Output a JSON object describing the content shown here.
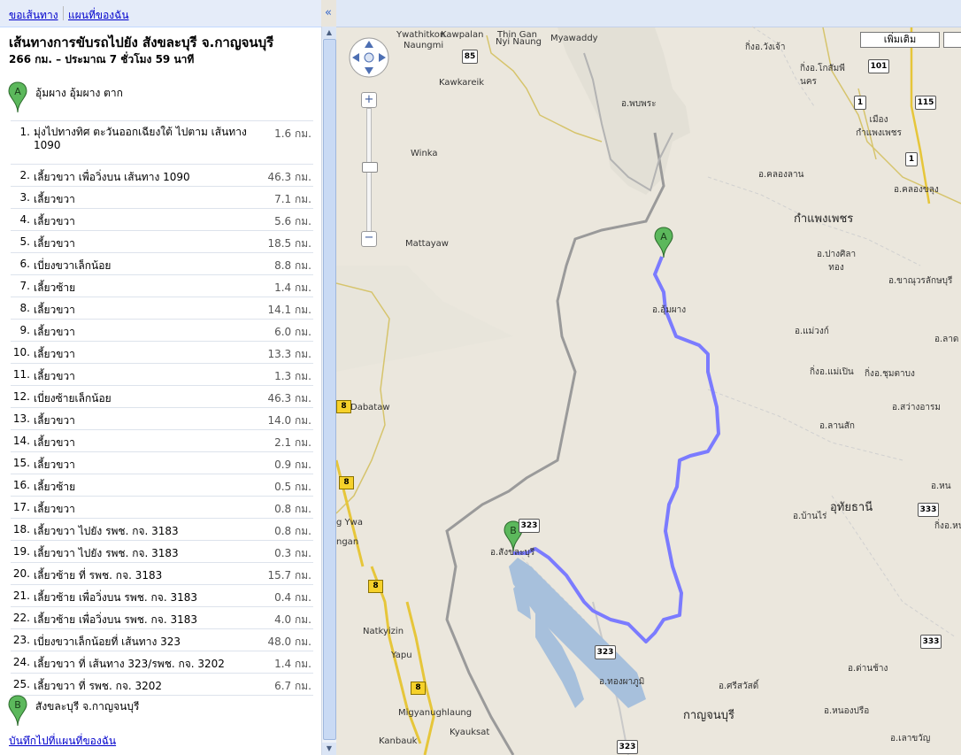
{
  "tabs": {
    "directions": "ขอเส้นทาง",
    "my_maps": "แผนที่ของฉัน"
  },
  "collapse_glyph": "«",
  "route": {
    "title": "เส้นทางการขับรถไปยัง สังขละบุรี จ.กาญจนบุรี",
    "summary": "266 กม. – ประมาณ 7 ชั่วโมง 59 นาที",
    "origin": {
      "marker": "A",
      "label": "อุ้มผาง อุ้มผาง ตาก"
    },
    "destination": {
      "marker": "B",
      "label": "สังขละบุรี จ.กาญจนบุรี"
    },
    "save_link": "บันทึกไปที่แผนที่ของฉัน",
    "steps": [
      {
        "num": "1.",
        "text": "มุ่งไปทางทิศ ตะวันออกเฉียงใต้ ไปตาม เส้นทาง 1090",
        "dist": "1.6 กม."
      },
      {
        "num": "2.",
        "text": "เลี้ยวขวา เพื่อวิ่งบน เส้นทาง 1090",
        "dist": "46.3 กม."
      },
      {
        "num": "3.",
        "text": "เลี้ยวขวา",
        "dist": "7.1 กม."
      },
      {
        "num": "4.",
        "text": "เลี้ยวขวา",
        "dist": "5.6 กม."
      },
      {
        "num": "5.",
        "text": "เลี้ยวขวา",
        "dist": "18.5 กม."
      },
      {
        "num": "6.",
        "text": "เบี่ยงขวาเล็กน้อย",
        "dist": "8.8 กม."
      },
      {
        "num": "7.",
        "text": "เลี้ยวซ้าย",
        "dist": "1.4 กม."
      },
      {
        "num": "8.",
        "text": "เลี้ยวขวา",
        "dist": "14.1 กม."
      },
      {
        "num": "9.",
        "text": "เลี้ยวขวา",
        "dist": "6.0 กม."
      },
      {
        "num": "10.",
        "text": "เลี้ยวขวา",
        "dist": "13.3 กม."
      },
      {
        "num": "11.",
        "text": "เลี้ยวขวา",
        "dist": "1.3 กม."
      },
      {
        "num": "12.",
        "text": "เบี่ยงซ้ายเล็กน้อย",
        "dist": "46.3 กม."
      },
      {
        "num": "13.",
        "text": "เลี้ยวขวา",
        "dist": "14.0 กม."
      },
      {
        "num": "14.",
        "text": "เลี้ยวขวา",
        "dist": "2.1 กม."
      },
      {
        "num": "15.",
        "text": "เลี้ยวขวา",
        "dist": "0.9 กม."
      },
      {
        "num": "16.",
        "text": "เลี้ยวซ้าย",
        "dist": "0.5 กม."
      },
      {
        "num": "17.",
        "text": "เลี้ยวขวา",
        "dist": "0.8 กม."
      },
      {
        "num": "18.",
        "text": "เลี้ยวขวา ไปยัง รพช. กจ. 3183",
        "dist": "0.8 กม."
      },
      {
        "num": "19.",
        "text": "เลี้ยวขวา ไปยัง รพช. กจ. 3183",
        "dist": "0.3 กม."
      },
      {
        "num": "20.",
        "text": "เลี้ยวซ้าย ที่ รพช. กจ. 3183",
        "dist": "15.7 กม."
      },
      {
        "num": "21.",
        "text": "เลี้ยวซ้าย เพื่อวิ่งบน รพช. กจ. 3183",
        "dist": "0.4 กม."
      },
      {
        "num": "22.",
        "text": "เลี้ยวซ้าย เพื่อวิ่งบน รพช. กจ. 3183",
        "dist": "4.0 กม."
      },
      {
        "num": "23.",
        "text": "เบี่ยงขวาเล็กน้อยที่ เส้นทาง 323",
        "dist": "48.0 กม."
      },
      {
        "num": "24.",
        "text": "เลี้ยวขวา ที่ เส้นทาง 323/รพช. กจ. 3202",
        "dist": "1.4 กม."
      },
      {
        "num": "25.",
        "text": "เลี้ยวขวา ที่ รพช. กจ. 3202",
        "dist": "6.7 กม."
      }
    ]
  },
  "map": {
    "more_button": "เพิ่มเติม",
    "route_color": "#7b7bff",
    "marker_color": "#5cb85c",
    "labels": {
      "ywathitkon": "Ywathitkon",
      "kawpalan": "Kawpalan",
      "thingan": "Thin Gan",
      "nyinaung": "Nyi Naung",
      "myawaddy": "Myawaddy",
      "naungmi": "Naungmi",
      "kawkareik": "Kawkareik",
      "winka": "Winka",
      "mattayaw": "Mattayaw",
      "dabataw": "Dabataw",
      "ngangan": "ngan",
      "gywa": "g Ywa",
      "natkyizin": "Natkyizin",
      "yapu": "Yapu",
      "miganughlaung": "Migyanughlaung",
      "kanbauk": "Kanbauk",
      "kyauksat": "Kyauksat",
      "kiwangchao": "กิ่งอ.วังเจ้า",
      "kikosamphon": "กิ่งอ.โกสัมพีนคร",
      "phopphra": "อ.พบพระ",
      "mueangkp": "เมืองกำแพงเพชร",
      "khlonglan": "อ.คลองลาน",
      "khlongkhlung": "อ.คลองขลุง",
      "kamphaengphet": "กำแพงเพชร",
      "pangsilathong": "อ.ปางศิลาทอง",
      "khanuworalak": "อ.ขาณุวรลักษบุรี",
      "umphang": "อ.อุ้มผาง",
      "maewong": "อ.แม่วงก์",
      "lat": "อ.ลาด",
      "kimaepoen": "กิ่งอ.แม่เปิน",
      "kichumtabong": "กิ่งอ.ชุมตาบง",
      "sawangarom": "อ.สว่างอารม",
      "lansak": "อ.ลานสัก",
      "uthaithani": "อุทัยธานี",
      "nong": "อ.หน",
      "banrai": "อ.บ้านไร่",
      "kinongma": "กิ่งอ.หน",
      "sangkhlaburi": "อ.สังขละบุรี",
      "thongphaphum": "อ.ทองผาภูมิ",
      "srisawat": "อ.ศรีสวัสดิ์",
      "kanchanaburi": "กาญจนบุรี",
      "danchang": "อ.ด่านช้าง",
      "nongprue": "อ.หนองปรือ",
      "laoyai": "อ.เลาขวัญ"
    },
    "roads": {
      "r85": "85",
      "r101": "101",
      "r1a": "1",
      "r115": "115",
      "r1b": "1",
      "r8a": "8",
      "r8b": "8",
      "r8c": "8",
      "r8d": "8",
      "r323a": "323",
      "r323b": "323",
      "r323c": "323",
      "r333a": "333",
      "r333b": "333"
    }
  }
}
